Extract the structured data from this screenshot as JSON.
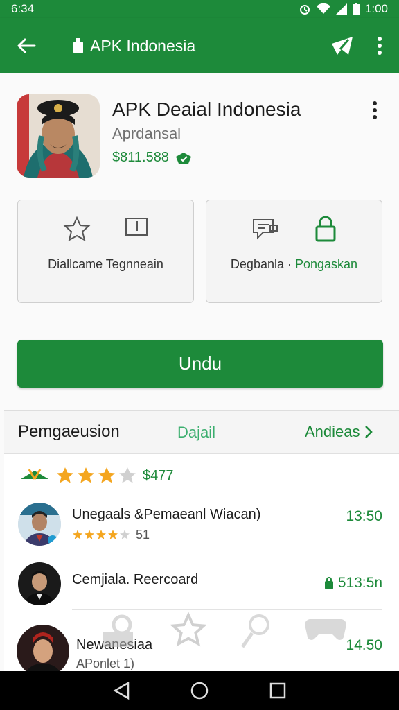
{
  "status": {
    "time": "6:34",
    "clock": "1:00"
  },
  "appbar": {
    "title": "APK Indonesia",
    "back_icon": "arrow-left-icon",
    "lock_icon": "lock-icon",
    "share_icon": "share-icon",
    "more_icon": "more-vert-icon"
  },
  "app": {
    "name": "APK Deaial Indonesia",
    "developer": "Aprdansal",
    "price": "$811.588",
    "price_icon": "badge-icon"
  },
  "cards": {
    "left_label": "Diallcame Tegnneain",
    "right_label_a": "Degbanla ·",
    "right_label_b": "Pongaskan"
  },
  "install_label": "Undu",
  "reviews": {
    "title": "Pemgaeusion",
    "tab": "Dajail",
    "more": "Andieas",
    "rating_count": "$477",
    "rating_value": 3,
    "items": [
      {
        "name": "Unegaals &Pemaeanl Wiacan)",
        "sub": "51",
        "time": "13:50",
        "stars": 3.5
      },
      {
        "name": "Cemjiala. Reercoard",
        "time": "513:5n"
      },
      {
        "name": "Newanesiaa",
        "sub": "APonlet 1)",
        "time": "14.50"
      }
    ]
  },
  "colors": {
    "primary": "#1d8a3a",
    "star": "#f4a620",
    "accent_light": "#3bae6e"
  }
}
